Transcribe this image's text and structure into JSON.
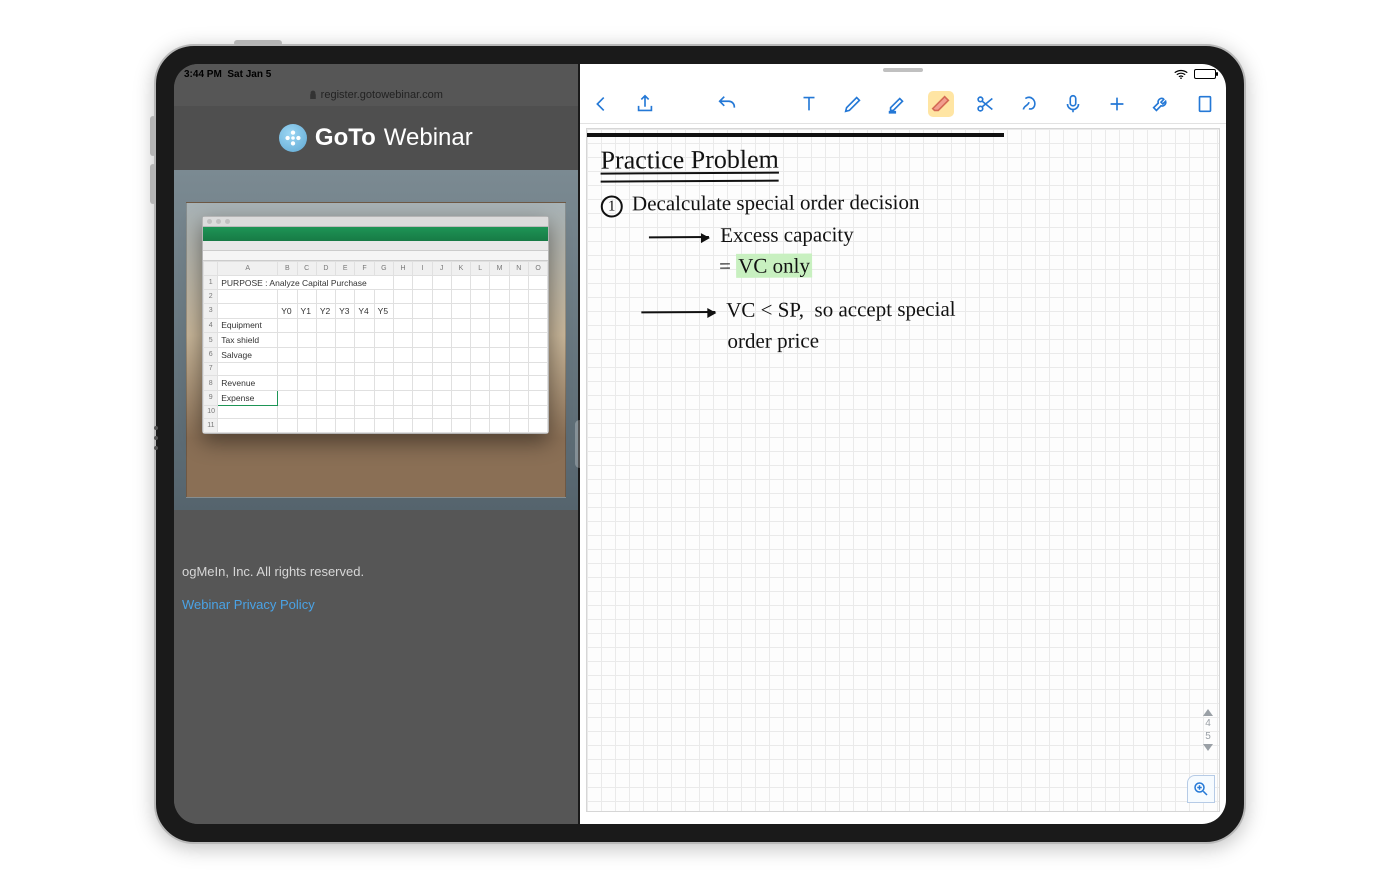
{
  "status": {
    "time": "3:44 PM",
    "date": "Sat Jan 5"
  },
  "safari": {
    "url": "register.gotowebinar.com"
  },
  "webinar": {
    "brand_bold": "GoTo",
    "brand_light": "Webinar",
    "footer_rights": "ogMeIn, Inc. All rights reserved.",
    "footer_link": "Webinar Privacy Policy"
  },
  "excel": {
    "purpose": "PURPOSE : Analyze Capital Purchase",
    "col_headers": [
      "A",
      "B",
      "C",
      "D",
      "E",
      "F",
      "G",
      "H",
      "I",
      "J",
      "K",
      "L",
      "M",
      "N",
      "O"
    ],
    "year_labels": [
      "Y0",
      "Y1",
      "Y2",
      "Y3",
      "Y4",
      "Y5"
    ],
    "row_labels": [
      "Equipment",
      "Tax shield",
      "Salvage",
      "",
      "Revenue",
      "Expense"
    ]
  },
  "notes": {
    "tools": {
      "back": "back-icon",
      "share": "share-icon",
      "undo": "undo-icon",
      "text": "text-tool-icon",
      "pen": "pen-tool-icon",
      "highlighter": "highlighter-tool-icon",
      "eraser": "eraser-tool-icon",
      "scissors": "scissors-tool-icon",
      "lasso": "lasso-tool-icon",
      "mic": "mic-icon",
      "add": "add-icon",
      "wrench": "wrench-icon",
      "page": "page-icon"
    },
    "page_indicator": {
      "top": "4",
      "bottom": "5"
    },
    "text": {
      "title": "Practice Problem",
      "line1_num": "1",
      "line1": "Decalculate special order decision",
      "line2": "Excess capacity",
      "line3_eq": "=",
      "line3_hl": "VC only",
      "line4a": "VC < SP,",
      "line4b": "so accept special",
      "line5": "order price"
    }
  }
}
